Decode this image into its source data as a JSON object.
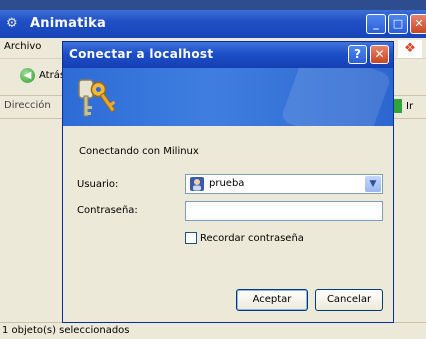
{
  "explorer": {
    "title": "Animatika",
    "menu_first": "Archivo",
    "back_label": "Atrás",
    "address_label": "Dirección",
    "go_label": "Ir",
    "status_text": "1 objeto(s) seleccionados"
  },
  "dialog": {
    "title": "Conectar a localhost",
    "help_glyph": "?",
    "close_glyph": "✕",
    "connecting_text": "Conectando con Milinux",
    "user_label": "Usuario:",
    "user_value": "prueba",
    "password_label": "Contraseña:",
    "password_value": "",
    "remember_label": "Recordar contraseña",
    "remember_checked": false,
    "ok_label": "Aceptar",
    "cancel_label": "Cancelar"
  },
  "colors": {
    "titlebar": "#1f4fc4",
    "banner": "#2d6cd6",
    "window_bg": "#ece9d8",
    "close_red": "#c94722"
  },
  "icons": {
    "keys": "keys-icon",
    "user": "user-icon",
    "back": "back-arrow-icon",
    "go": "go-arrow-icon"
  }
}
